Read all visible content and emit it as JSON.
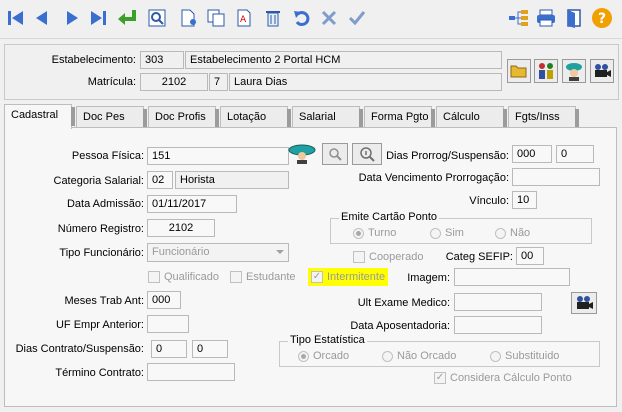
{
  "toolbar": {
    "icons": [
      "first-record-icon",
      "previous-record-icon",
      "next-record-icon",
      "last-record-icon",
      "return-icon",
      "search-window-icon",
      "new-document-icon",
      "copy-icon",
      "spellcheck-document-icon",
      "delete-icon",
      "undo-icon",
      "cancel-icon",
      "confirm-icon",
      "hierarchy-icon",
      "print-icon",
      "exit-door-icon",
      "help-icon"
    ]
  },
  "header": {
    "estabelecimento_label": "Estabelecimento:",
    "estabelecimento_code": "303",
    "estabelecimento_name": "Estabelecimento 2 Portal HCM",
    "matricula_label": "Matrícula:",
    "matricula_value": "2102",
    "matricula_digit": "7",
    "employee_name": "Laura Dias"
  },
  "tabs": [
    {
      "label": "Cadastral",
      "active": true
    },
    {
      "label": "Doc Pes",
      "active": false
    },
    {
      "label": "Doc Profis",
      "active": false
    },
    {
      "label": "Lotação",
      "active": false
    },
    {
      "label": "Salarial",
      "active": false
    },
    {
      "label": "Forma Pgto",
      "active": false
    },
    {
      "label": "Cálculo",
      "active": false
    },
    {
      "label": "Fgts/Inss",
      "active": false
    }
  ],
  "form": {
    "pessoa_fisica_label": "Pessoa Física:",
    "pessoa_fisica_value": "151",
    "dias_prorrog_label": "Dias Prorrog/Suspensão:",
    "dias_prorrog_1": "000",
    "dias_prorrog_2": "0",
    "categoria_label": "Categoria Salarial:",
    "categoria_code": "02",
    "categoria_name": "Horista",
    "data_venc_label": "Data Vencimento Prorrogação:",
    "data_venc_value": "",
    "data_admissao_label": "Data Admissão:",
    "data_admissao_value": "01/11/2017",
    "vinculo_label": "Vínculo:",
    "vinculo_value": "10",
    "numero_registro_label": "Número Registro:",
    "numero_registro_value": "2102",
    "emite_cartao_title": "Emite Cartão Ponto",
    "emite_options": [
      {
        "label": "Turno",
        "selected": true
      },
      {
        "label": "Sim",
        "selected": false
      },
      {
        "label": "Não",
        "selected": false
      }
    ],
    "tipo_funcionario_label": "Tipo Funcionário:",
    "tipo_funcionario_value": "Funcionário",
    "cooperado_label": "Cooperado",
    "categ_sefip_label": "Categ SEFIP:",
    "categ_sefip_value": "00",
    "qualificado_label": "Qualificado",
    "estudante_label": "Estudante",
    "intermitente_label": "Intermitente",
    "imagem_label": "Imagem:",
    "meses_trab_label": "Meses Trab Ant:",
    "meses_trab_value": "000",
    "ult_exame_label": "Ult Exame Medico:",
    "uf_empr_label": "UF Empr Anterior:",
    "data_apos_label": "Data Aposentadoria:",
    "dias_contrato_label": "Dias Contrato/Suspensão:",
    "dias_contrato_1": "0",
    "dias_contrato_2": "0",
    "tipo_estatistica_title": "Tipo Estatística",
    "tipo_estatistica_options": [
      {
        "label": "Orcado",
        "selected": true
      },
      {
        "label": "Não Orcado",
        "selected": false
      },
      {
        "label": "Substituido",
        "selected": false
      }
    ],
    "termino_label": "Término Contrato:",
    "considera_label": "Considera Cálculo Ponto",
    "highlight_color": "#ffff00"
  }
}
